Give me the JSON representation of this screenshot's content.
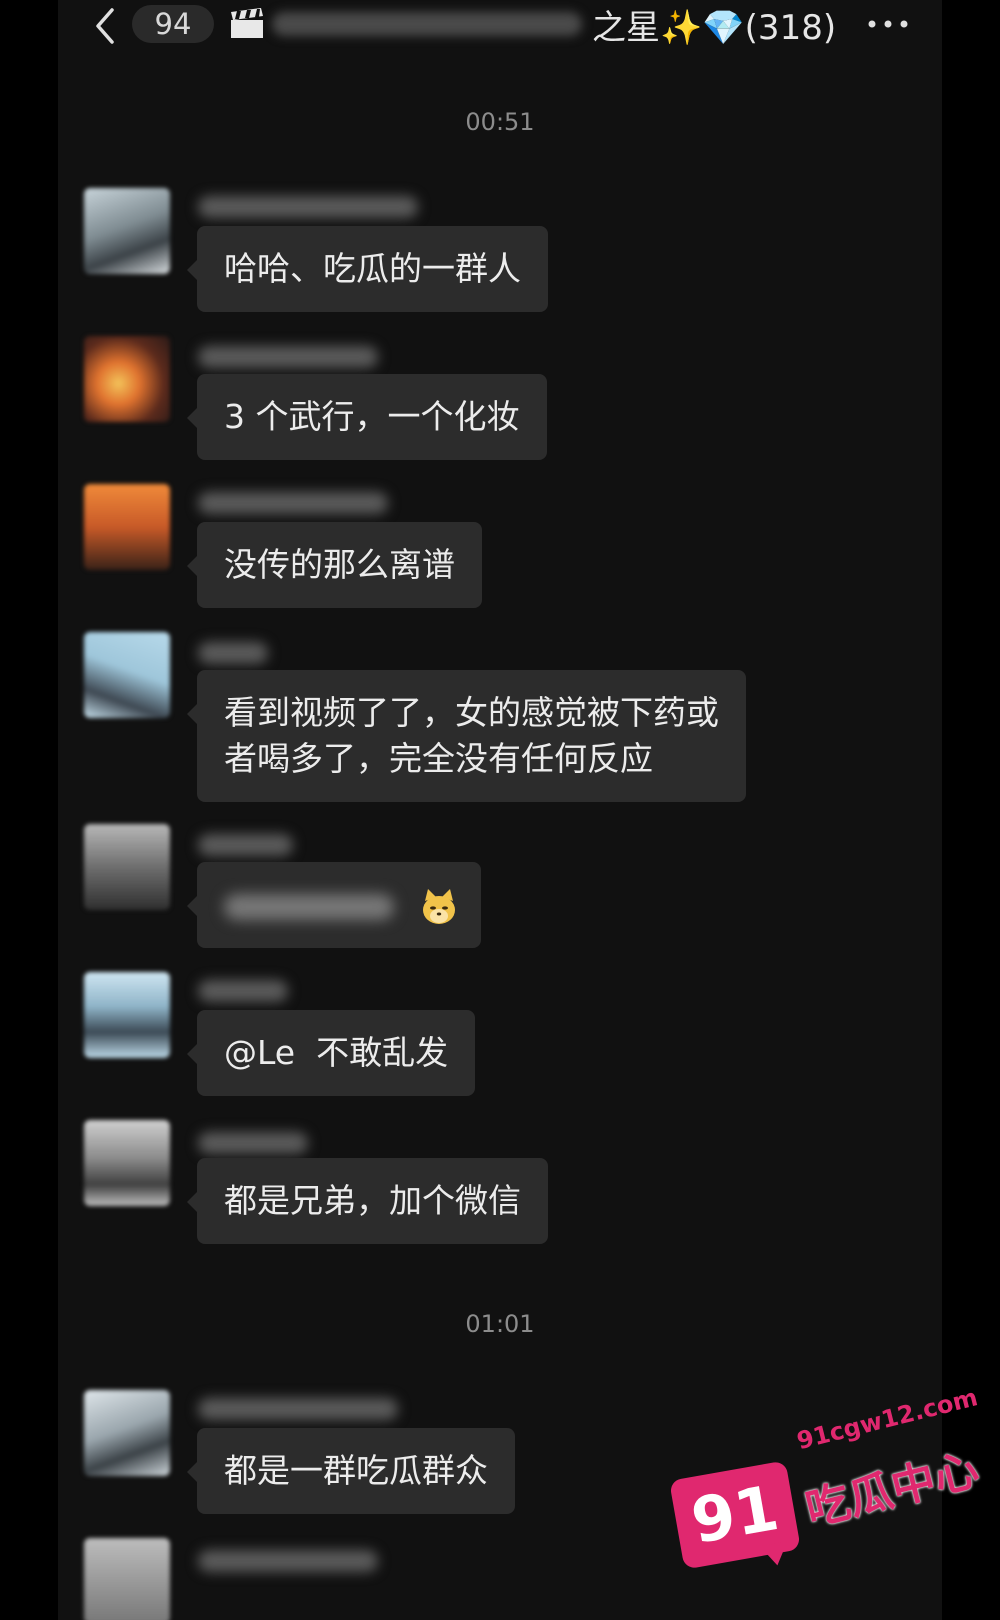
{
  "header": {
    "unread_count": "94",
    "title_visible": "之星✨💎(318)",
    "title_icon": "clapperboard-icon"
  },
  "timestamps": [
    "00:51",
    "01:01"
  ],
  "messages": [
    {
      "text": "哈哈、吃瓜的一群人"
    },
    {
      "text": "3 个武行，一个化妆"
    },
    {
      "text": "没传的那么离谱"
    },
    {
      "line1": "看到视频了了，女的感觉被下药或",
      "line2": "者喝多了，完全没有任何反应"
    },
    {
      "emoji": "doge-cat-icon"
    },
    {
      "text": "@Le  不敢乱发"
    },
    {
      "text": "都是兄弟，加个微信"
    },
    {
      "text": "都是一群吃瓜群众"
    }
  ],
  "watermark": {
    "number": "91",
    "url": "91cgw12.com",
    "name": "吃瓜中心",
    "color": "#e0286f"
  }
}
